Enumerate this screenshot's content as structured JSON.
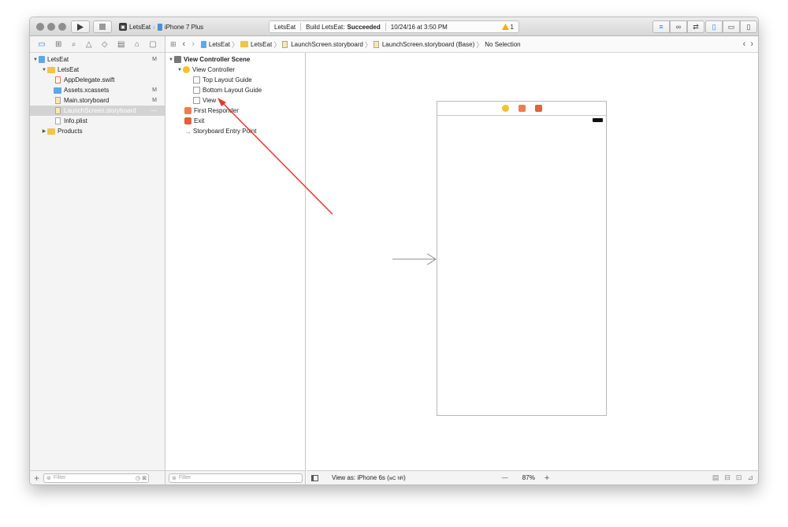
{
  "toolbar": {
    "scheme_target": "LetsEat",
    "scheme_device": "iPhone 7 Plus",
    "activity_project": "LetsEat",
    "activity_build_prefix": "Build LetsEat:",
    "activity_build_status": "Succeeded",
    "activity_time": "10/24/16 at 3:50 PM",
    "warning_count": "1"
  },
  "navigator": {
    "tabs": [
      "folder-icon",
      "hierarchy-icon",
      "search-icon",
      "warning-icon",
      "test-icon",
      "debug-icon",
      "breakpoint-icon",
      "report-icon"
    ],
    "items": [
      {
        "label": "LetsEat",
        "badge": "M"
      },
      {
        "label": "LetsEat",
        "badge": ""
      },
      {
        "label": "AppDelegate.swift",
        "badge": ""
      },
      {
        "label": "Assets.xcassets",
        "badge": "M"
      },
      {
        "label": "Main.storyboard",
        "badge": "M"
      },
      {
        "label": "LaunchScreen.storyboard",
        "badge": "—"
      },
      {
        "label": "Info.plist",
        "badge": ""
      },
      {
        "label": "Products",
        "badge": ""
      }
    ],
    "filter_placeholder": "Filter"
  },
  "jumpbar": {
    "crumbs": [
      "LetsEat",
      "LetsEat",
      "LaunchScreen.storyboard",
      "LaunchScreen.storyboard (Base)",
      "No Selection"
    ]
  },
  "outline": {
    "items": [
      {
        "label": "View Controller Scene"
      },
      {
        "label": "View Controller"
      },
      {
        "label": "Top Layout Guide"
      },
      {
        "label": "Bottom Layout Guide"
      },
      {
        "label": "View"
      },
      {
        "label": "First Responder"
      },
      {
        "label": "Exit"
      },
      {
        "label": "Storyboard Entry Point"
      }
    ],
    "filter_placeholder": "Filter"
  },
  "canvas_bar": {
    "view_as_prefix": "View as: iPhone 6s (",
    "size_w": "wC",
    "size_h": "hR",
    "view_as_suffix": ")",
    "zoom_minus": "—",
    "zoom": "87%",
    "zoom_plus": "+"
  },
  "colors": {
    "accent": "#2f7de1",
    "folder": "#f3c34a",
    "vc_yellow": "#f5c12e",
    "responder_orange": "#ec7e4f",
    "arrow_red": "#e03a2f"
  }
}
